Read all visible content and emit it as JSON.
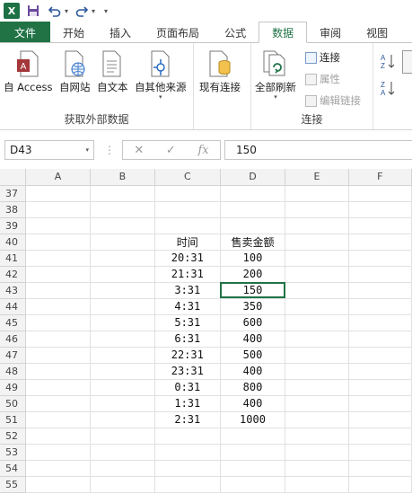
{
  "qat": {
    "excel_label": "X"
  },
  "tabs": [
    {
      "label": "文件",
      "kind": "file"
    },
    {
      "label": "开始"
    },
    {
      "label": "插入"
    },
    {
      "label": "页面布局"
    },
    {
      "label": "公式"
    },
    {
      "label": "数据",
      "active": true
    },
    {
      "label": "审阅"
    },
    {
      "label": "视图"
    }
  ],
  "ribbon": {
    "external_group": {
      "label": "获取外部数据",
      "buttons": [
        "自 Access",
        "自网站",
        "自文本",
        "自其他来源"
      ]
    },
    "existing_conn": "现有连接",
    "conn_group": {
      "label": "连接",
      "refresh_all": "全部刷新",
      "connections": "连接",
      "properties": "属性",
      "edit_links": "编辑链接"
    }
  },
  "formula": {
    "name_box": "D43",
    "fx_label": "fx",
    "value": "150"
  },
  "columns": [
    "A",
    "B",
    "C",
    "D",
    "E",
    "F"
  ],
  "rows": [
    {
      "n": "37",
      "c": "",
      "d": ""
    },
    {
      "n": "38",
      "c": "",
      "d": ""
    },
    {
      "n": "39",
      "c": "",
      "d": ""
    },
    {
      "n": "40",
      "c": "时间",
      "d": "售卖金额"
    },
    {
      "n": "41",
      "c": "20:31",
      "d": "100"
    },
    {
      "n": "42",
      "c": "21:31",
      "d": "200"
    },
    {
      "n": "43",
      "c": "3:31",
      "d": "150"
    },
    {
      "n": "44",
      "c": "4:31",
      "d": "350"
    },
    {
      "n": "45",
      "c": "5:31",
      "d": "600"
    },
    {
      "n": "46",
      "c": "6:31",
      "d": "400"
    },
    {
      "n": "47",
      "c": "22:31",
      "d": "500"
    },
    {
      "n": "48",
      "c": "23:31",
      "d": "400"
    },
    {
      "n": "49",
      "c": "0:31",
      "d": "800"
    },
    {
      "n": "50",
      "c": "1:31",
      "d": "400"
    },
    {
      "n": "51",
      "c": "2:31",
      "d": "1000"
    },
    {
      "n": "52",
      "c": "",
      "d": ""
    },
    {
      "n": "53",
      "c": "",
      "d": ""
    },
    {
      "n": "54",
      "c": "",
      "d": ""
    },
    {
      "n": "55",
      "c": "",
      "d": ""
    }
  ]
}
